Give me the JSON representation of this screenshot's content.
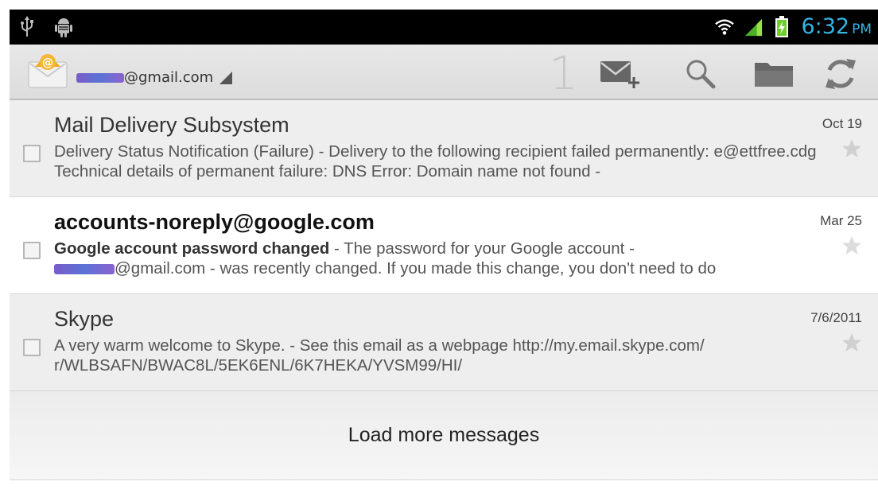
{
  "status_bar": {
    "left_icons": [
      "usb-icon",
      "android-debug-icon"
    ],
    "right_icons": [
      "wifi-icon",
      "signal-icon",
      "battery-charging-icon"
    ],
    "time": "6:32",
    "ampm": "PM",
    "accent_color": "#33b5e5"
  },
  "action_bar": {
    "account_suffix": "@gmail.com",
    "unread_count": "1",
    "icons": [
      "compose-icon",
      "search-icon",
      "folder-icon",
      "refresh-icon"
    ]
  },
  "messages": [
    {
      "sender": "Mail Delivery Subsystem",
      "date": "Oct 19",
      "subject": "",
      "snippet": "Delivery Status Notification (Failure) - Delivery to the following recipient failed permanently: e@ettfree.cdg Technical details of permanent failure: DNS Error: Domain name not found -",
      "read": true,
      "starred": false
    },
    {
      "sender": "accounts-noreply@google.com",
      "date": "Mar 25",
      "subject": "Google account password changed",
      "snippet_part1": " - The password for your Google account - ",
      "snippet_part2": "@gmail.com - was recently changed. If you made this change, you don't need to do",
      "read": false,
      "starred": false
    },
    {
      "sender": "Skype",
      "date": "7/6/2011",
      "subject": "",
      "snippet": "A very warm welcome to Skype. - See this email as a webpage http://my.email.skype.com/ r/WLBSAFN/BWAC8L/5EK6ENL/6K7HEKA/YVSM99/HI/",
      "read": true,
      "starred": false
    }
  ],
  "load_more_label": "Load more messages"
}
